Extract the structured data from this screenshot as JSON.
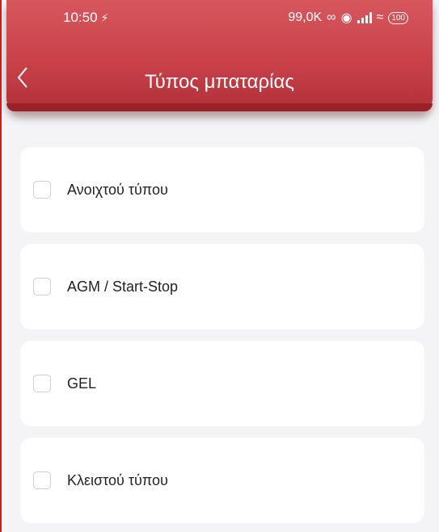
{
  "status_bar": {
    "time": "10:50",
    "network_speed": "99,0K",
    "battery": "100"
  },
  "header": {
    "title": "Τύπος μπαταρίας",
    "back_icon": "chevron-left-icon"
  },
  "options": [
    {
      "label": "Ανοιχτού τύπου",
      "checked": false
    },
    {
      "label": "AGM / Start-Stop",
      "checked": false
    },
    {
      "label": "GEL",
      "checked": false
    },
    {
      "label": "Κλειστού τύπου",
      "checked": false
    }
  ],
  "colors": {
    "header": "#c9424a",
    "background": "#f4f4f6",
    "card": "#ffffff",
    "text": "#222222"
  }
}
